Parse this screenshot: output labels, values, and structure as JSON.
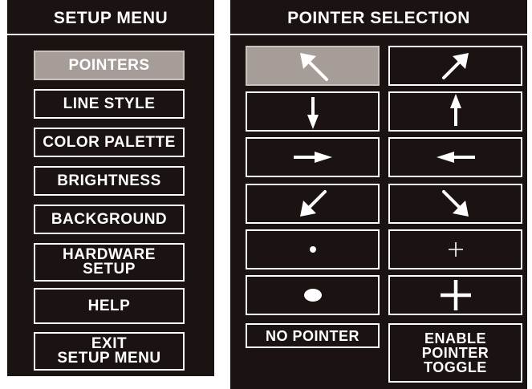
{
  "setup_menu": {
    "title": "SETUP MENU",
    "items": [
      {
        "label": "POINTERS"
      },
      {
        "label": "LINE STYLE"
      },
      {
        "label": "COLOR PALETTE"
      },
      {
        "label": "BRIGHTNESS"
      },
      {
        "label": "BACKGROUND"
      },
      {
        "label": "HARDWARE\nSETUP"
      },
      {
        "label": "HELP"
      },
      {
        "label": "EXIT\nSETUP MENU"
      }
    ],
    "selected": "POINTERS"
  },
  "pointer_selection": {
    "title": "POINTER SELECTION",
    "options": [
      {
        "icon": "arrow-up-left-icon"
      },
      {
        "icon": "arrow-up-right-icon"
      },
      {
        "icon": "arrow-down-icon"
      },
      {
        "icon": "arrow-up-icon"
      },
      {
        "icon": "arrow-right-icon"
      },
      {
        "icon": "arrow-left-icon"
      },
      {
        "icon": "arrow-down-left-icon"
      },
      {
        "icon": "arrow-down-right-icon"
      },
      {
        "icon": "small-dot-icon"
      },
      {
        "icon": "small-crosshair-icon"
      },
      {
        "icon": "large-dot-icon"
      },
      {
        "icon": "large-crosshair-icon"
      }
    ],
    "selected_icon": "arrow-up-left-icon",
    "no_pointer_label": "NO POINTER",
    "toggle_label": "ENABLE\nPOINTER\nTOGGLE"
  },
  "colors": {
    "panel_bg": "#1b1312",
    "selected_bg": "#a69c98",
    "foreground": "#ffffff",
    "page_bg": "#ffffff"
  }
}
